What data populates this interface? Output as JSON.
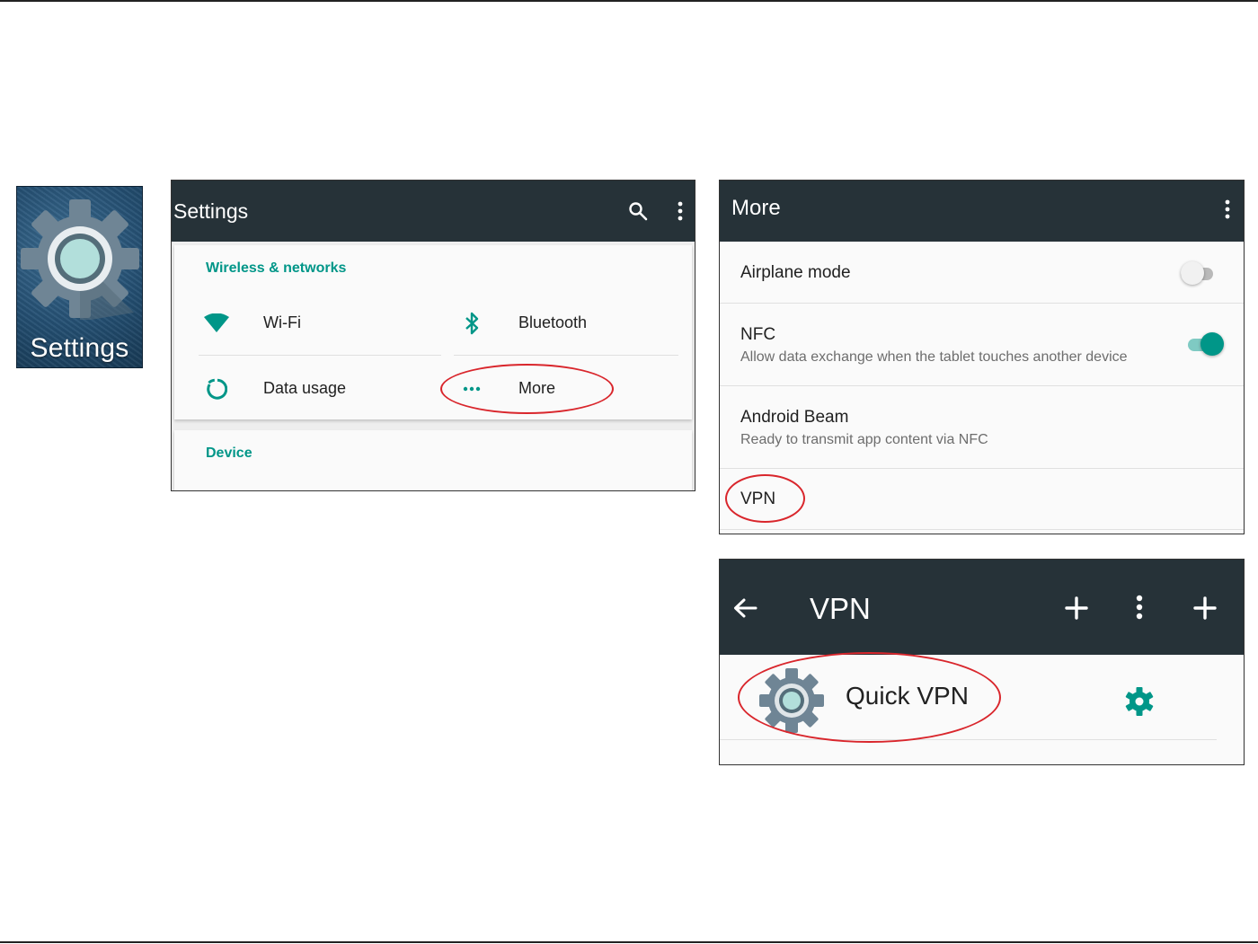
{
  "app_icon": {
    "label": "Settings",
    "icon": "settings-gear-icon"
  },
  "settings_screen": {
    "title": "Settings",
    "actions": [
      "search-icon",
      "overflow-menu-icon"
    ],
    "section_wireless": "Wireless & networks",
    "tiles": [
      {
        "label": "Wi-Fi",
        "icon": "wifi-icon"
      },
      {
        "label": "Bluetooth",
        "icon": "bluetooth-icon"
      },
      {
        "label": "Data usage",
        "icon": "data-usage-icon"
      },
      {
        "label": "More",
        "icon": "more-dots-icon"
      }
    ],
    "section_device": "Device",
    "accent_color": "#009688"
  },
  "more_screen": {
    "title": "More",
    "rows": [
      {
        "title": "Airplane mode",
        "subtitle": "",
        "toggle": "off"
      },
      {
        "title": "NFC",
        "subtitle": "Allow data exchange when the tablet touches another device",
        "toggle": "on"
      },
      {
        "title": "Android Beam",
        "subtitle": "Ready to transmit app content via NFC"
      },
      {
        "title": "VPN",
        "subtitle": ""
      }
    ]
  },
  "vpn_screen": {
    "title": "VPN",
    "actions": [
      "add-icon",
      "overflow-menu-icon",
      "add-icon"
    ],
    "items": [
      {
        "label": "Quick VPN",
        "icon": "settings-gear-icon",
        "action_icon": "gear-icon"
      }
    ]
  },
  "colors": {
    "appbar": "#263238",
    "accent": "#009688",
    "highlight_circle": "#d9262c"
  }
}
